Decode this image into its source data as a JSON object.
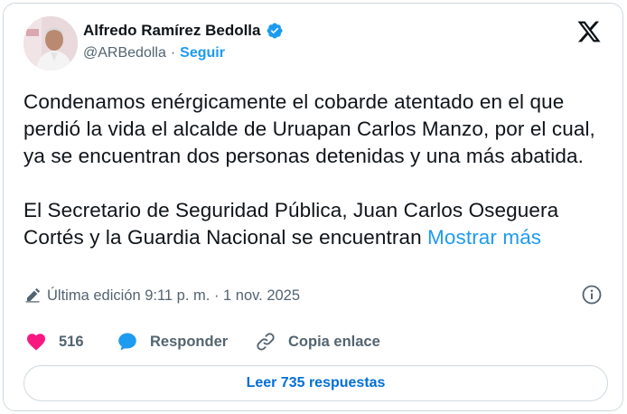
{
  "author": {
    "name": "Alfredo Ramírez Bedolla",
    "handle": "@ARBedolla",
    "separator": "·",
    "follow_label": "Seguir"
  },
  "icons": {
    "verified": "verified-badge-icon",
    "brand": "x-logo-icon",
    "edit": "pencil-icon",
    "info": "info-icon",
    "like": "heart-icon",
    "reply": "speech-bubble-icon",
    "copy": "link-icon"
  },
  "tweet": {
    "paragraph1": "Condenamos enérgicamente el cobarde atentado en el que perdió la vida el alcalde de Uruapan Carlos Manzo, por el cual, ya se encuentran dos personas detenidas y una más abatida.",
    "paragraph2": "El Secretario de Seguridad Pública, Juan Carlos Oseguera Cortés y la Guardia Nacional se encuentran",
    "show_more": "Mostrar más"
  },
  "meta": {
    "edited": "Última edición 9:11 p. m. · 1 nov. 2025"
  },
  "actions": {
    "likes": "516",
    "reply_label": "Responder",
    "copy_label": "Copia enlace"
  },
  "replies_button": "Leer 735 respuestas",
  "colors": {
    "accent": "#1d9bf0",
    "like": "#f91880",
    "text": "#0f1419",
    "muted": "#536471",
    "border": "#cfd9de"
  }
}
